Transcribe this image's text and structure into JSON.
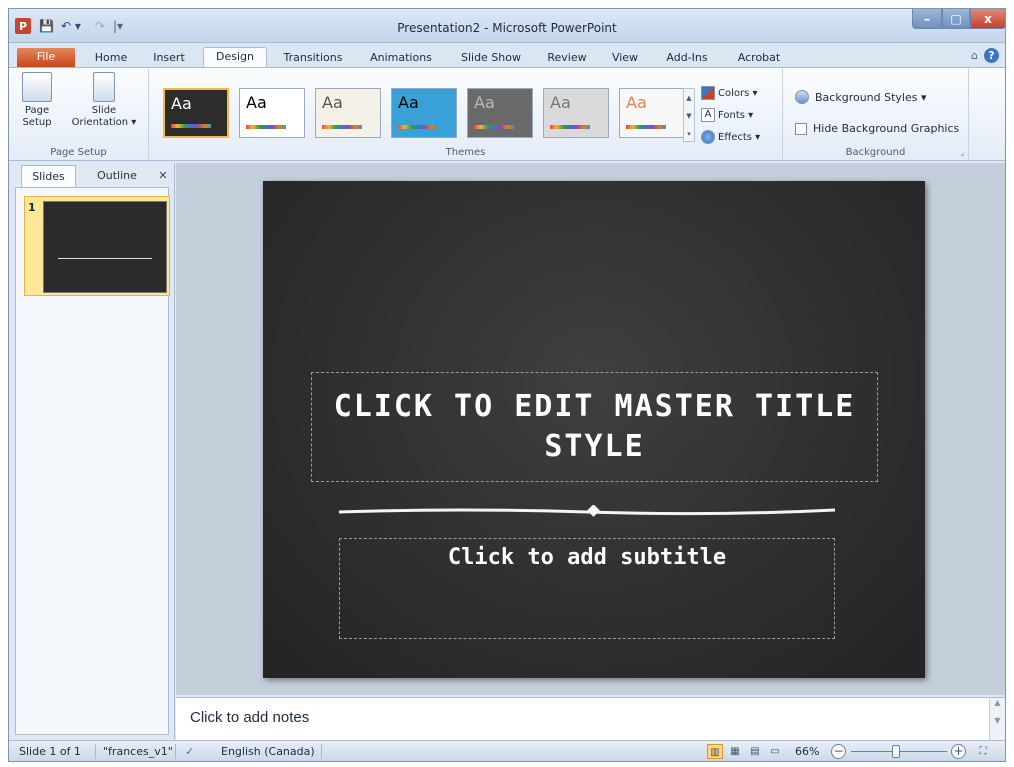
{
  "window": {
    "title": "Presentation2 - Microsoft PowerPoint"
  },
  "qat": {
    "app_icon": "P",
    "save": "💾",
    "undo": "↶ ▾",
    "redo": "↷",
    "customize": "|▾"
  },
  "window_controls": {
    "minimize": "–",
    "maximize": "□",
    "close": "x"
  },
  "tabs": [
    "File",
    "Home",
    "Insert",
    "Design",
    "Transitions",
    "Animations",
    "Slide Show",
    "Review",
    "View",
    "Add-Ins",
    "Acrobat"
  ],
  "help": {
    "minimize_ribbon": "⌂",
    "help": "?"
  },
  "ribbon": {
    "page_setup": {
      "group_label": "Page Setup",
      "page_setup_line1": "Page",
      "page_setup_line2": "Setup",
      "orientation_line1": "Slide",
      "orientation_line2": "Orientation ▾"
    },
    "themes": {
      "group_label": "Themes",
      "thumbs": [
        {
          "label": "Aa",
          "bg": "#2c2c2c",
          "fg": "#ffffff"
        },
        {
          "label": "Aa",
          "bg": "#ffffff",
          "fg": "#000000"
        },
        {
          "label": "Aa",
          "bg": "#f4f1e8",
          "fg": "#555555"
        },
        {
          "label": "Aa",
          "bg": "#3aa0d8",
          "fg": "#000000"
        },
        {
          "label": "Aa",
          "bg": "#6a6a6a",
          "fg": "#bbbbbb"
        },
        {
          "label": "Aa",
          "bg": "#d9d9d9",
          "fg": "#777777"
        },
        {
          "label": "Aa",
          "bg": "#f7f7f7",
          "fg": "#e8834a"
        }
      ],
      "colors": "Colors ▾",
      "fonts": "Fonts ▾",
      "effects": "Effects ▾"
    },
    "background": {
      "group_label": "Background",
      "styles": "Background Styles ▾",
      "hide_graphics": "Hide Background Graphics"
    }
  },
  "slides_pane": {
    "tab_slides": "Slides",
    "tab_outline": "Outline",
    "close": "✕",
    "slide_number": "1"
  },
  "slide": {
    "title_placeholder": "CLICK TO EDIT MASTER TITLE STYLE",
    "subtitle_placeholder": "Click to add subtitle"
  },
  "notes": {
    "placeholder": "Click to add notes"
  },
  "status": {
    "slide_info": "Slide 1 of 1",
    "theme_name": "\"frances_v1\"",
    "language": "English (Canada)",
    "zoom": "66%",
    "zoom_out": "−",
    "zoom_in": "+",
    "zoom_level": 0.47
  },
  "colors": {
    "accent": "#c5461d",
    "slide_bg": "#2f2f2f",
    "selection": "#fde89a"
  }
}
